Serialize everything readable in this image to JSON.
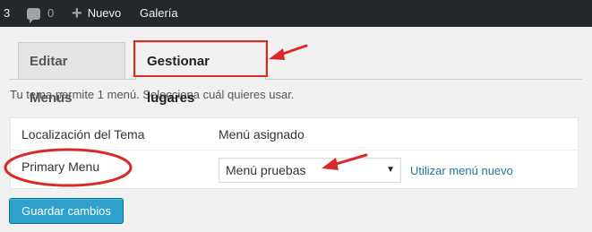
{
  "admin_bar": {
    "updates_count": "3",
    "comments_count": "0",
    "new_label": "Nuevo",
    "gallery_label": "Galería",
    "icons": [
      "comment-bubble-icon",
      "plus-icon"
    ]
  },
  "tabs": [
    {
      "label": "Editar Menús",
      "active": false
    },
    {
      "label": "Gestionar lugares",
      "active": true
    }
  ],
  "description": "Tu tema permite 1 menú. Selecciona cuál quieres usar.",
  "locations_table": {
    "headers": [
      "Localización del Tema",
      "Menú asignado"
    ],
    "rows": [
      {
        "location": "Primary Menu",
        "selected_menu": "Menú pruebas",
        "link": "Utilizar menú nuevo"
      }
    ]
  },
  "save_button": "Guardar cambios",
  "colors": {
    "admin_bar": "#23282d",
    "button": "#2ea2cc",
    "link": "#21759b",
    "annotation": "#d92a2a"
  }
}
